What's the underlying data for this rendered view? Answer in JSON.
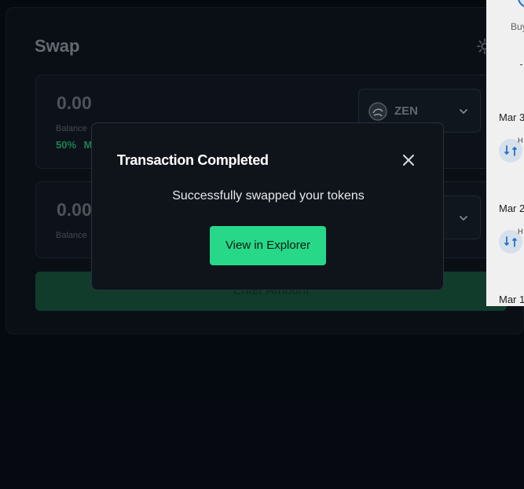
{
  "swap": {
    "title": "Swap",
    "from": {
      "amount": "0.00",
      "balance_label": "Balance",
      "percent_label": "50%",
      "max_label": "M",
      "token": "ZEN"
    },
    "to": {
      "amount": "0.00",
      "balance_label": "Balance"
    },
    "enter_button": "Enter Amount"
  },
  "sidebar": {
    "buy_label": "Buy",
    "dates": [
      "Mar 3",
      "Mar 2",
      "Mar 1"
    ],
    "tx_tag": "H"
  },
  "modal": {
    "title": "Transaction Completed",
    "message": "Successfully swapped your tokens",
    "explorer_button": "View in Explorer"
  },
  "colors": {
    "accent": "#27d888",
    "background": "#060a12",
    "modal_bg": "#0f141b"
  }
}
